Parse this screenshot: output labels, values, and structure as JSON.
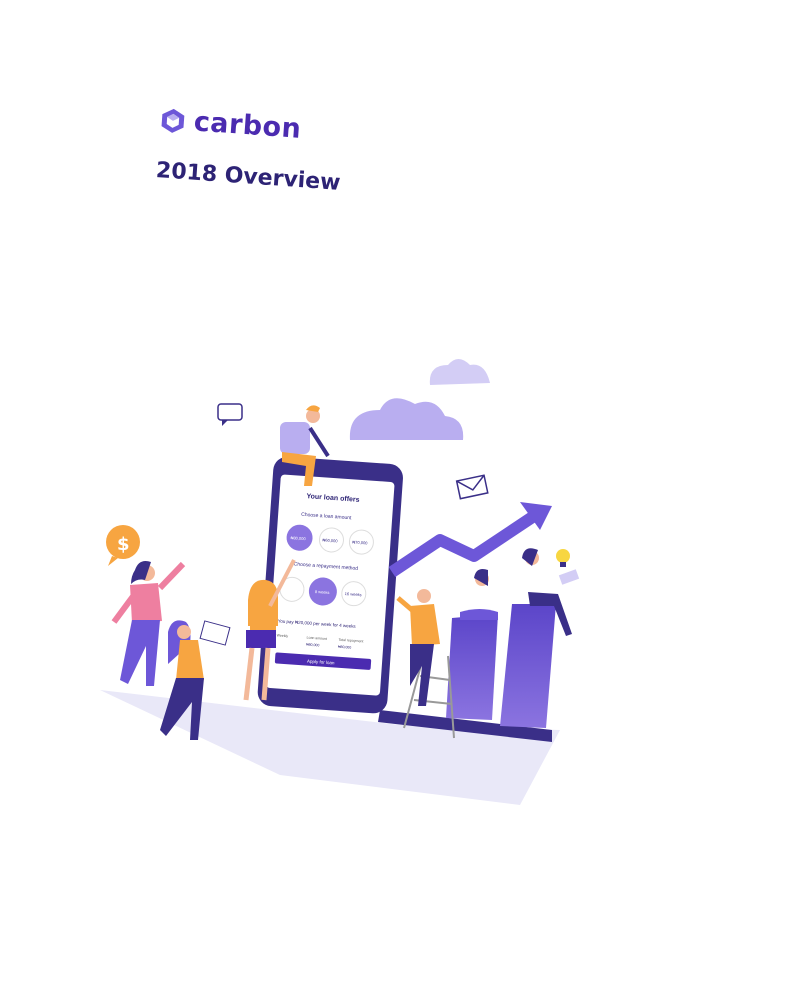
{
  "brand": {
    "name": "carbon",
    "accent": "#4b2bb0",
    "title_color": "#2d2375"
  },
  "cover": {
    "title": "2018 Overview"
  },
  "phone": {
    "header": "Your loan offers",
    "amount_prompt": "Choose a loan amount",
    "amount_options": [
      "₦80,000",
      "₦60,000",
      "₦70,000"
    ],
    "repayment_prompt": "Choose a repayment method",
    "repayment_options": [
      "8 weeks",
      "16 weeks"
    ],
    "summary": "You pay ₦20,000 per week for 4 weeks",
    "detail_labels": [
      "Weekly",
      "Loan amount",
      "Total repayment"
    ],
    "detail_values": [
      "₦80,000",
      "₦80,000"
    ],
    "cta": "Apply for loan"
  },
  "icons": [
    "carbon-logo-icon",
    "dollar-coin-icon",
    "chat-bubble-icon",
    "envelope-icon",
    "lightbulb-icon",
    "cloud-icon",
    "growth-arrow-icon"
  ],
  "colors": {
    "purple": "#6d57d8",
    "lavender": "#b9aef0",
    "orange": "#f7a541",
    "pink": "#ee7fa0",
    "navy": "#3a2f88",
    "shadow": "#e9e8f8"
  }
}
